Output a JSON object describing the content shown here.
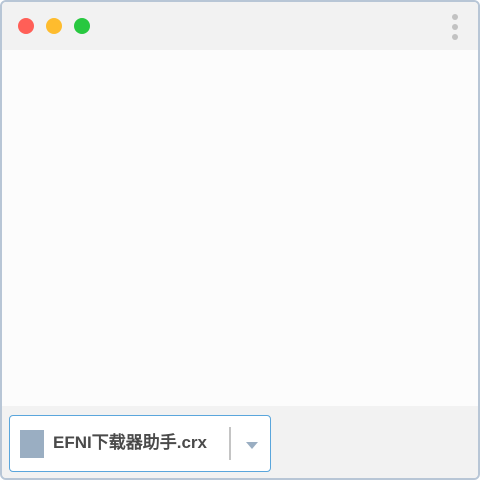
{
  "window": {
    "controls": [
      "close",
      "minimize",
      "maximize"
    ],
    "colors": {
      "close": "#ff5f57",
      "minimize": "#febc2e",
      "maximize": "#28c840"
    },
    "menu_icon": "kebab-menu-icon"
  },
  "download_shelf": {
    "item": {
      "file_icon": "file-icon",
      "filename": "EFNI下载器助手.crx",
      "dropdown_icon": "chevron-down-icon",
      "border_color": "#5aa6dc"
    }
  }
}
